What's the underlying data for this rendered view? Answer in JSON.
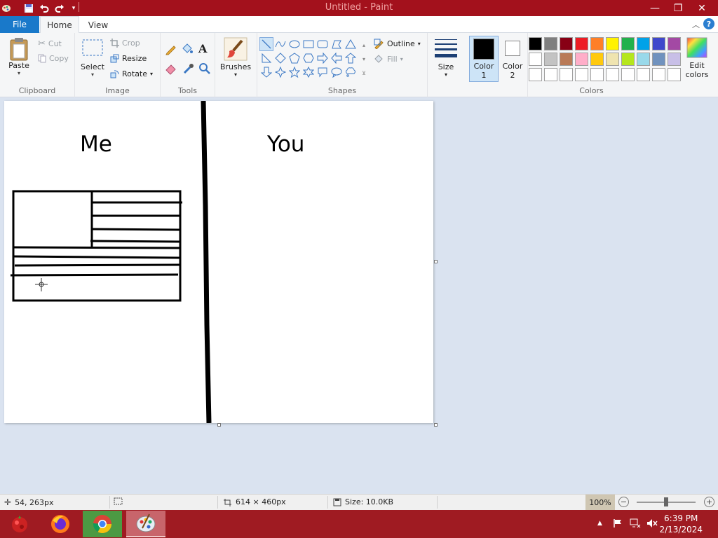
{
  "window": {
    "title": "Untitled - Paint",
    "minimize_glyph": "—",
    "maximize_glyph": "❐",
    "close_glyph": "✕"
  },
  "menu": {
    "file_label": "File",
    "tabs": [
      {
        "label": "Home"
      },
      {
        "label": "View"
      }
    ],
    "active_tab": "Home"
  },
  "ribbon": {
    "clipboard": {
      "label": "Clipboard",
      "paste": "Paste",
      "cut": "Cut",
      "copy": "Copy"
    },
    "image": {
      "label": "Image",
      "select": "Select",
      "crop": "Crop",
      "resize": "Resize",
      "rotate": "Rotate"
    },
    "tools": {
      "label": "Tools",
      "items": [
        "pencil-icon",
        "fill-icon",
        "text-icon",
        "eraser-icon",
        "color-picker-icon",
        "magnifier-icon"
      ]
    },
    "brushes": {
      "label": "Brushes"
    },
    "shapes": {
      "label": "Shapes",
      "outline": "Outline",
      "fill": "Fill",
      "items": [
        "line",
        "curve",
        "oval",
        "rectangle",
        "rounded-rectangle",
        "polygon",
        "triangle",
        "right-triangle",
        "diamond",
        "pentagon",
        "hexagon",
        "right-arrow",
        "left-arrow",
        "up-arrow",
        "down-arrow",
        "four-point-star",
        "five-point-star",
        "six-point-star",
        "rounded-callout",
        "oval-callout",
        "cloud-callout"
      ],
      "selected": "line"
    },
    "size": {
      "label": "Size"
    },
    "color1": {
      "label": "Color",
      "number": "1",
      "value": "#000000"
    },
    "color2": {
      "label": "Color",
      "number": "2",
      "value": "#ffffff"
    },
    "colors": {
      "label": "Colors",
      "palette": [
        "#000000",
        "#7f7f7f",
        "#880015",
        "#ed1c24",
        "#ff7f27",
        "#fff200",
        "#22b14c",
        "#00a2e8",
        "#3f48cc",
        "#a349a4",
        "#ffffff",
        "#c3c3c3",
        "#b97a57",
        "#ffaec9",
        "#ffc90e",
        "#efe4b0",
        "#b5e61d",
        "#99d9ea",
        "#7092be",
        "#c8bfe7",
        "#ffffff",
        "#ffffff",
        "#ffffff",
        "#ffffff",
        "#ffffff",
        "#ffffff",
        "#ffffff",
        "#ffffff",
        "#ffffff",
        "#ffffff"
      ],
      "edit_label_1": "Edit",
      "edit_label_2": "colors"
    }
  },
  "canvas": {
    "labels": {
      "left": "Me",
      "right": "You"
    },
    "background": "#ffffff"
  },
  "status": {
    "cursor_pos": "54, 263px",
    "canvas_size": "614 × 460px",
    "file_size": "Size: 10.0KB",
    "zoom": "100%",
    "zoom_out": "−",
    "zoom_in": "+"
  },
  "taskbar": {
    "apps": [
      "app-icon",
      "firefox-icon",
      "chrome-icon",
      "paint-icon"
    ],
    "time": "6:39 PM",
    "date": "2/13/2024"
  }
}
